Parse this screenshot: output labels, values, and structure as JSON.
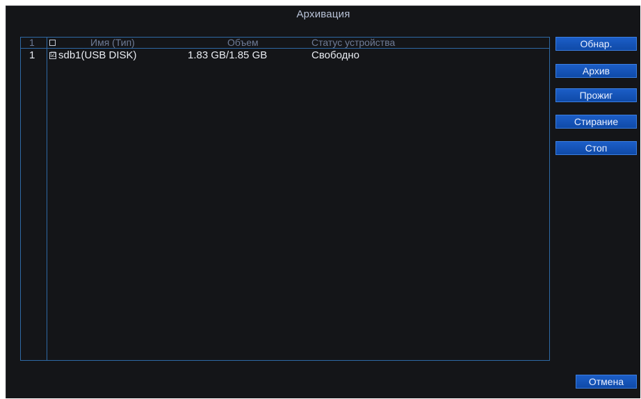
{
  "window": {
    "title": "Архивация"
  },
  "table": {
    "header": {
      "index": "1",
      "name": "Имя (Тип)",
      "size": "Объем",
      "status": "Статус устройства"
    },
    "rows": [
      {
        "index": "1",
        "checked": true,
        "check_glyph": "☑",
        "name": "sdb1(USB DISK)",
        "size": "1.83 GB/1.85 GB",
        "status": "Свободно"
      }
    ]
  },
  "buttons": {
    "detect": "Обнар.",
    "backup": "Архив",
    "burn": "Прожиг",
    "erase": "Стирание",
    "stop": "Стоп",
    "cancel": "Отмена"
  },
  "colors": {
    "background": "#141518",
    "border": "#2f6aa6",
    "button": "#1557bd",
    "header_text": "#6f7c97"
  }
}
